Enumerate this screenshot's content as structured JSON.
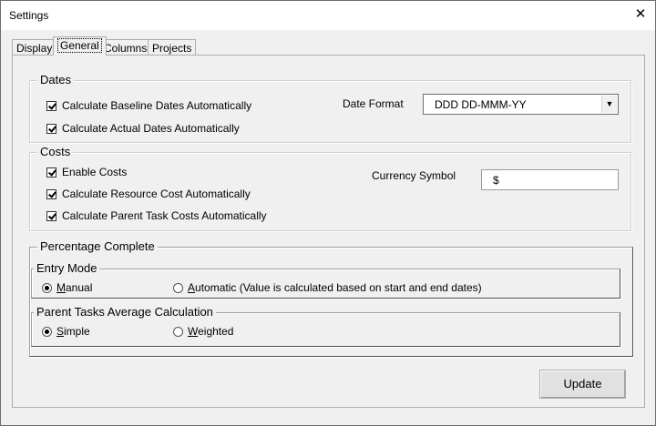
{
  "window": {
    "title": "Settings",
    "close_glyph": "✕"
  },
  "tabs": [
    {
      "label": "Display",
      "active": false
    },
    {
      "label": "General",
      "active": true
    },
    {
      "label": "Columns",
      "active": false
    },
    {
      "label": "Projects",
      "active": false
    }
  ],
  "dates": {
    "title": "Dates",
    "baseline_label": "Calculate Baseline Dates Automatically",
    "baseline_checked": true,
    "actual_label": "Calculate Actual Dates Automatically",
    "actual_checked": true,
    "format_label": "Date Format",
    "format_value": "DDD DD-MMM-YY"
  },
  "costs": {
    "title": "Costs",
    "enable_label": "Enable Costs",
    "enable_checked": true,
    "resource_label": "Calculate Resource Cost Automatically",
    "resource_checked": true,
    "parent_label": "Calculate Parent Task Costs Automatically",
    "parent_checked": true,
    "currency_label": "Currency Symbol",
    "currency_value": "$"
  },
  "percentage": {
    "title": "Percentage Complete",
    "entry_mode": {
      "title": "Entry Mode",
      "manual_first": "M",
      "manual_rest": "anual",
      "automatic_first": "A",
      "automatic_rest": "utomatic (Value is calculated based on start and end dates)",
      "selected": "manual"
    },
    "average": {
      "title": "Parent Tasks Average Calculation",
      "simple_first": "S",
      "simple_rest": "imple",
      "weighted_first": "W",
      "weighted_rest": "eighted",
      "selected": "simple"
    }
  },
  "update_label": "Update",
  "icons": {
    "close": "close-icon",
    "dropdown": "chevron-down-icon"
  }
}
